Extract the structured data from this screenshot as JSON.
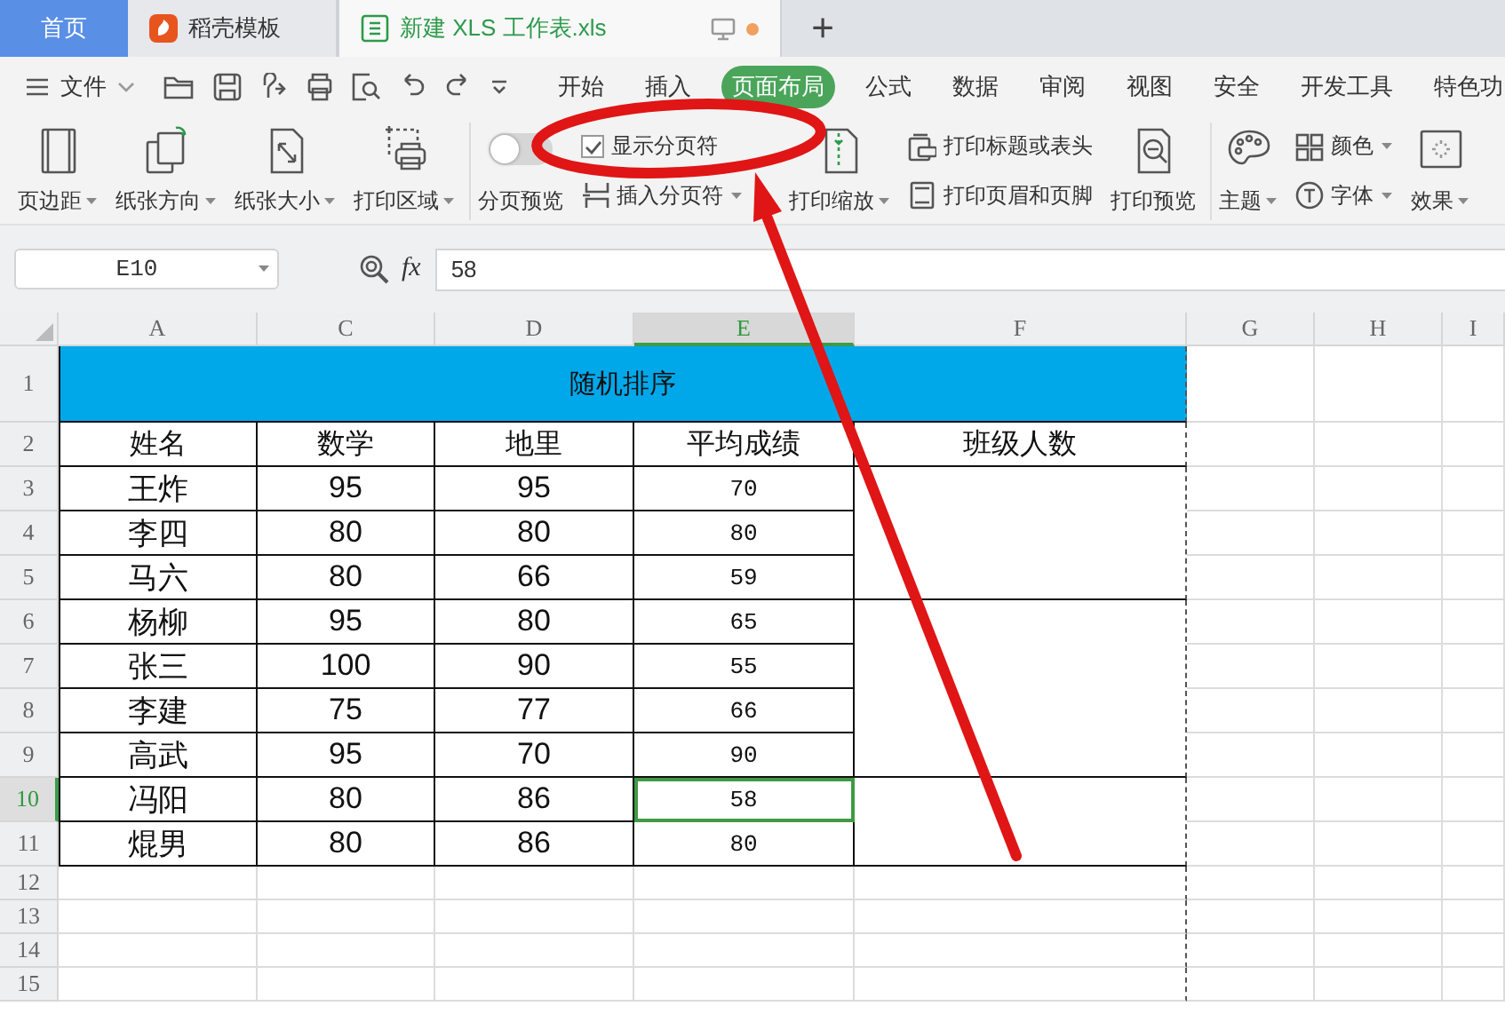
{
  "tabs": [
    {
      "kind": "home",
      "label": "首页",
      "selected": false
    },
    {
      "kind": "templates",
      "label": "稻壳模板",
      "selected": false
    },
    {
      "kind": "document",
      "label": "新建 XLS 工作表.xls",
      "selected": true,
      "unsaved": true
    }
  ],
  "new_tab": "+",
  "menu": {
    "file": "文件",
    "tabs": [
      {
        "label": "开始",
        "selected": false
      },
      {
        "label": "插入",
        "selected": false
      },
      {
        "label": "页面布局",
        "selected": true
      },
      {
        "label": "公式",
        "selected": false
      },
      {
        "label": "数据",
        "selected": false
      },
      {
        "label": "审阅",
        "selected": false
      },
      {
        "label": "视图",
        "selected": false
      },
      {
        "label": "安全",
        "selected": false
      },
      {
        "label": "开发工具",
        "selected": false
      },
      {
        "label": "特色功",
        "selected": false
      }
    ]
  },
  "ribbon": [
    [
      [
        {
          "kind": "big",
          "label": "页边距",
          "dropdown": true
        }
      ],
      [
        {
          "kind": "big",
          "label": "纸张方向",
          "dropdown": true
        }
      ],
      [
        {
          "kind": "big",
          "label": "纸张大小",
          "dropdown": true
        }
      ],
      [
        {
          "kind": "big",
          "label": "打印区域",
          "dropdown": true
        }
      ]
    ],
    [
      [
        {
          "kind": "switch",
          "label": "分页预览",
          "on": false
        }
      ],
      [
        {
          "kind": "check",
          "label": "显示分页符",
          "checked": true
        },
        {
          "kind": "small",
          "label": "插入分页符",
          "dropdown": true
        }
      ],
      [
        {
          "kind": "big",
          "label": "打印缩放",
          "dropdown": true
        }
      ],
      [
        {
          "kind": "small",
          "label": "打印标题或表头",
          "dropdown": false
        },
        {
          "kind": "small",
          "label": "打印页眉和页脚",
          "dropdown": false
        }
      ],
      [
        {
          "kind": "big",
          "label": "打印预览",
          "dropdown": false
        }
      ]
    ],
    [
      [
        {
          "kind": "big",
          "label": "主题",
          "dropdown": true
        }
      ],
      [
        {
          "kind": "small",
          "label": "颜色",
          "dropdown": true
        },
        {
          "kind": "small",
          "label": "字体",
          "dropdown": true
        }
      ],
      [
        {
          "kind": "big",
          "label": "效果",
          "dropdown": true
        }
      ]
    ]
  ],
  "formula_bar": {
    "name_box": "E10",
    "fx": "fx",
    "formula": "58"
  },
  "sheet": {
    "columns": [
      {
        "label": "A",
        "selected": false
      },
      {
        "label": "C",
        "selected": false
      },
      {
        "label": "D",
        "selected": false
      },
      {
        "label": "E",
        "selected": true
      },
      {
        "label": "F",
        "selected": false
      },
      {
        "label": "G",
        "selected": false
      },
      {
        "label": "H",
        "selected": false
      },
      {
        "label": "I",
        "selected": false
      }
    ],
    "rows": [
      {
        "label": "1",
        "selected": false
      },
      {
        "label": "2",
        "selected": false
      },
      {
        "label": "3",
        "selected": false
      },
      {
        "label": "4",
        "selected": false
      },
      {
        "label": "5",
        "selected": false
      },
      {
        "label": "6",
        "selected": false
      },
      {
        "label": "7",
        "selected": false
      },
      {
        "label": "8",
        "selected": false
      },
      {
        "label": "9",
        "selected": false
      },
      {
        "label": "10",
        "selected": true
      },
      {
        "label": "11",
        "selected": false
      },
      {
        "label": "12",
        "selected": false
      },
      {
        "label": "13",
        "selected": false
      },
      {
        "label": "14",
        "selected": false
      },
      {
        "label": "15",
        "selected": false
      }
    ],
    "title": "随机排序",
    "header": [
      "姓名",
      "数学",
      "地里",
      "平均成绩",
      "班级人数"
    ],
    "records": [
      [
        "王炸",
        "95",
        "95",
        "70"
      ],
      [
        "李四",
        "80",
        "80",
        "80"
      ],
      [
        "马六",
        "80",
        "66",
        "59"
      ],
      [
        "杨柳",
        "95",
        "80",
        "65"
      ],
      [
        "张三",
        "100",
        "90",
        "55"
      ],
      [
        "李建",
        "75",
        "77",
        "66"
      ],
      [
        "高武",
        "95",
        "70",
        "90"
      ],
      [
        "冯阳",
        "80",
        "86",
        "58"
      ],
      [
        "焜男",
        "80",
        "86",
        "80"
      ]
    ]
  },
  "annotations": {
    "ellipse": {
      "color": "#e01515"
    },
    "arrow": {
      "color": "#e01515"
    }
  }
}
